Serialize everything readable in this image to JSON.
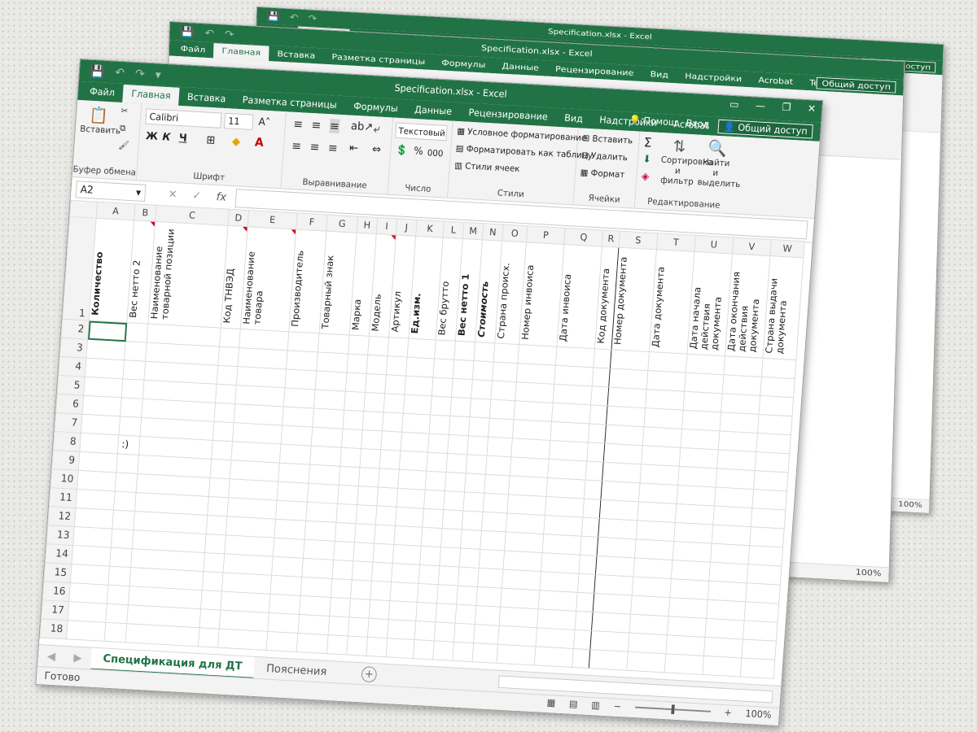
{
  "app": {
    "title": "Specification.xlsx - Excel",
    "close": "✕",
    "restore": "❐",
    "minimize": "—"
  },
  "tabs": [
    "Файл",
    "Главная",
    "Вставка",
    "Разметка страницы",
    "Формулы",
    "Данные",
    "Рецензирование",
    "Вид",
    "Надстройки",
    "Acrobat",
    "Team"
  ],
  "tabs_right": {
    "tellme": "Помощ",
    "signin": "Вход",
    "share": "Общий доступ"
  },
  "ribbon": {
    "clipboard": {
      "paste": "Вставить",
      "label": "Буфер обмена"
    },
    "font": {
      "name": "Calibri",
      "size": "11",
      "bold": "Ж",
      "italic": "К",
      "underline": "Ч",
      "label": "Шрифт"
    },
    "alignment": {
      "label": "Выравнивание"
    },
    "number": {
      "format": "Текстовый",
      "percent": "%",
      "thousands": "000",
      "label": "Число"
    },
    "styles": {
      "conditional": "Условное форматирование",
      "as_table": "Форматировать как таблицу",
      "cell_styles": "Стили ячеек",
      "label": "Стили"
    },
    "cells": {
      "insert": "Вставить",
      "delete": "Удалить",
      "format": "Формат",
      "label": "Ячейки"
    },
    "editing": {
      "sort": "Сортировка и фильтр",
      "find": "Найти и выделить",
      "label": "Редактирование"
    }
  },
  "formula_bar": {
    "name_box": "A2",
    "fx": "fx",
    "cancel": "✕",
    "enter": "✓"
  },
  "columns": [
    "A",
    "B",
    "C",
    "D",
    "E",
    "F",
    "G",
    "H",
    "I",
    "J",
    "K",
    "L",
    "M",
    "N",
    "O",
    "P",
    "Q",
    "R",
    "S",
    "T",
    "U",
    "V",
    "W"
  ],
  "headers": [
    "Количество",
    "Вес нетто 2",
    "Наименование товарной позиции",
    "Код ТНВЭД",
    "Наименование товара",
    "Производитель",
    "Товарный знак",
    "Марка",
    "Модель",
    "Артикул",
    "Ед.изм.",
    "Вес брутто",
    "Вес нетто 1",
    "Стоимость",
    "Страна происх.",
    "Номер инвоиса",
    "Дата инвоиса",
    "Код документа",
    "Номер документа",
    "Дата документа",
    "Дата начала действия документа",
    "Дата окончания действия документа",
    "Страна выдачи документа"
  ],
  "rows": [
    "1",
    "2",
    "3",
    "4",
    "5",
    "6",
    "7",
    "8",
    "9",
    "10",
    "11",
    "12",
    "13",
    "14",
    "15",
    "16",
    "17",
    "18"
  ],
  "cell_B8": ":)",
  "sheets": [
    "Спецификация для ДТ",
    "Пояснения"
  ],
  "status": {
    "ready": "Готово",
    "zoom": "100%"
  },
  "back_window": {
    "title": "Specification.xlsx - Excel",
    "share": "Общий доступ",
    "zoom": "100%"
  },
  "colors": {
    "accent": "#217346"
  }
}
